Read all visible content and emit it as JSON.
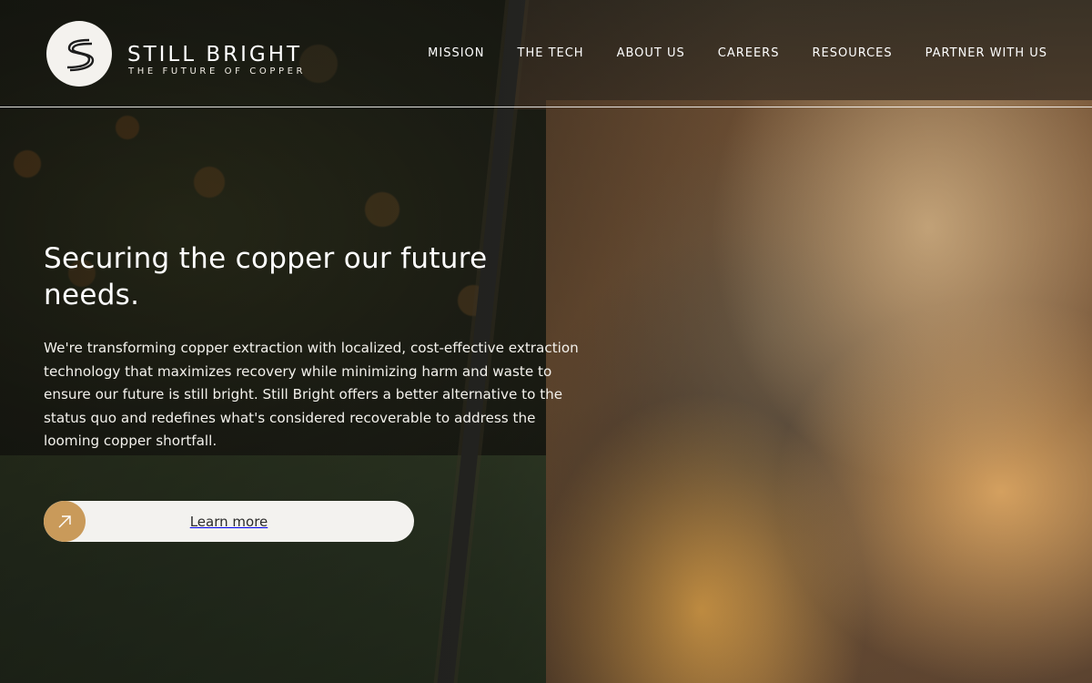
{
  "brand": {
    "name": "STILL BRIGHT",
    "tagline": "THE FUTURE OF COPPER",
    "logo_letter": "S"
  },
  "nav": {
    "items": [
      "MISSION",
      "THE TECH",
      "ABOUT US",
      "CAREERS",
      "RESOURCES",
      "PARTNER WITH US"
    ]
  },
  "hero": {
    "title": "Securing the copper our future needs.",
    "body": "We're transforming copper extraction with localized, cost-effective extraction technology that maximizes recovery while minimizing harm and waste to ensure our future is still bright.  Still Bright offers a better alternative to the status quo and redefines what's considered recoverable to address the looming copper shortfall.",
    "cta_label": "Learn more",
    "cta_icon": "arrow-up-right-icon"
  },
  "colors": {
    "accent": "#c99a5a",
    "button_bg": "#f3f2ef",
    "text": "#ffffff"
  }
}
